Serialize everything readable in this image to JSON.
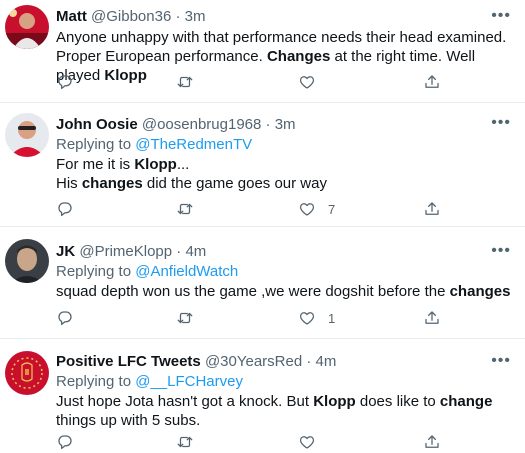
{
  "tweets": [
    {
      "name": "Matt",
      "handle": "@Gibbon36",
      "sep": "·",
      "time": "3m",
      "replying_prefix": "",
      "replying_to": "",
      "text_segments": [
        {
          "t": "Anyone unhappy with that performance needs their head examined. Proper European performance. ",
          "b": false
        },
        {
          "t": "Changes",
          "b": true
        },
        {
          "t": " at the right time. Well played ",
          "b": false
        },
        {
          "t": "Klopp",
          "b": true
        }
      ],
      "likes": ""
    },
    {
      "name": "John Oosie",
      "handle": "@oosenbrug1968",
      "sep": "·",
      "time": "3m",
      "replying_prefix": "Replying to ",
      "replying_to": "@TheRedmenTV",
      "text_segments": [
        {
          "t": "For me it is ",
          "b": false
        },
        {
          "t": "Klopp",
          "b": true
        },
        {
          "t": "...\nHis ",
          "b": false
        },
        {
          "t": "changes",
          "b": true
        },
        {
          "t": " did the game goes our way",
          "b": false
        }
      ],
      "likes": "7"
    },
    {
      "name": "JK",
      "handle": "@PrimeKlopp",
      "sep": "·",
      "time": "4m",
      "replying_prefix": "Replying to ",
      "replying_to": "@AnfieldWatch",
      "text_segments": [
        {
          "t": "squad depth won us the game ,we were dogshit before the ",
          "b": false
        },
        {
          "t": "changes",
          "b": true
        }
      ],
      "likes": "1"
    },
    {
      "name": "Positive LFC Tweets",
      "handle": "@30YearsRed",
      "sep": "·",
      "time": "4m",
      "replying_prefix": "Replying to ",
      "replying_to": "@__LFCHarvey",
      "text_segments": [
        {
          "t": "Just hope Jota hasn't got a knock. But ",
          "b": false
        },
        {
          "t": "Klopp",
          "b": true
        },
        {
          "t": " does like to ",
          "b": false
        },
        {
          "t": "change",
          "b": true
        },
        {
          "t": " things up with 5 subs.",
          "b": false
        }
      ],
      "likes": ""
    }
  ],
  "icons": {
    "more": "more-icon",
    "reply": "reply-icon",
    "retweet": "retweet-icon",
    "like": "like-icon",
    "share": "share-icon"
  },
  "colors": {
    "link": "#1d9bf0",
    "secondary": "#536471",
    "divider": "#e6ecf0"
  }
}
